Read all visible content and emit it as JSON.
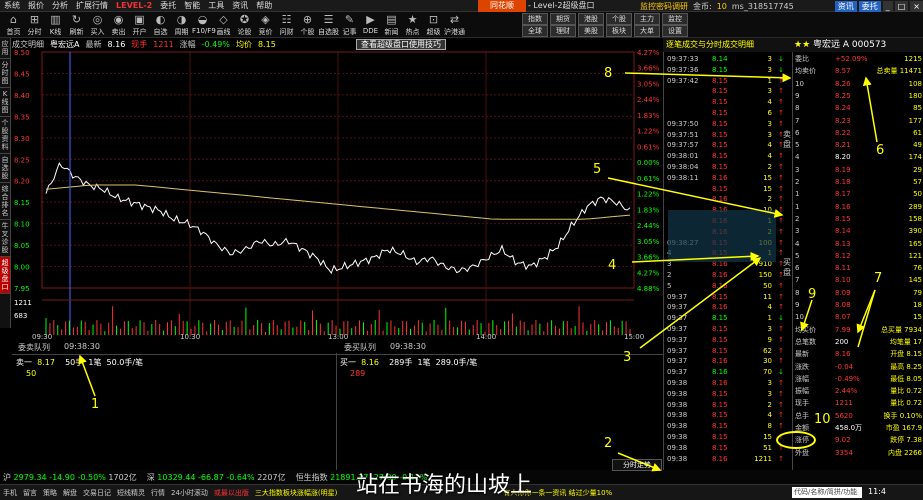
{
  "menubar": {
    "items": [
      "系统",
      "报价",
      "分析",
      "扩展行情",
      "LEVEL-2",
      "委托",
      "智能",
      "工具",
      "资讯",
      "帮助"
    ],
    "logo": "同花顺",
    "center_title": "- Level-2超级盘口",
    "account": "监控密码调研",
    "gold_label": "金币:",
    "gold_value": "10",
    "user": "ms_318517745",
    "btn1": "资讯",
    "btn2": "委托"
  },
  "toolbar": {
    "buttons": [
      {
        "icon": "⌂",
        "label": "首页"
      },
      {
        "icon": "⊞",
        "label": "分时"
      },
      {
        "icon": "▥",
        "label": "K线"
      },
      {
        "icon": "↻",
        "label": "刷新"
      },
      {
        "icon": "◎",
        "label": "买入"
      },
      {
        "icon": "◉",
        "label": "卖出"
      },
      {
        "icon": "▣",
        "label": "开户"
      },
      {
        "icon": "◐",
        "label": "自选"
      },
      {
        "icon": "◑",
        "label": "周期"
      },
      {
        "icon": "◒",
        "label": "F10/F9"
      },
      {
        "icon": "◇",
        "label": "画线"
      },
      {
        "icon": "✪",
        "label": "论股"
      },
      {
        "icon": "◈",
        "label": "竞价"
      },
      {
        "icon": "☷",
        "label": "问财"
      },
      {
        "icon": "⊕",
        "label": "个股"
      },
      {
        "icon": "☰",
        "label": "自选股"
      },
      {
        "icon": "✎",
        "label": "记事"
      },
      {
        "icon": "▶",
        "label": "DDE"
      },
      {
        "icon": "▤",
        "label": "新闻"
      },
      {
        "icon": "★",
        "label": "热点"
      },
      {
        "icon": "⊡",
        "label": "超级"
      },
      {
        "icon": "⇄",
        "label": "沪港通"
      }
    ],
    "right_buttons": [
      "指数",
      "全球",
      "期货",
      "理财",
      "港股",
      "美股",
      "个股",
      "板块",
      "主力",
      "大单",
      "监控",
      "设置"
    ]
  },
  "side_tabs": [
    "应用",
    "分时图",
    "K线图",
    "个股资料",
    "自选股",
    "综合排名",
    "牛叉诊股",
    "超级盘口"
  ],
  "chart_header": {
    "panel": "成交明细",
    "name": "粤宏远A",
    "last_label": "最新",
    "last": "8.16",
    "hand_label": "现手",
    "hand": "1211",
    "change_label": "涨幅",
    "change": "-0.49%",
    "avg_label": "均价",
    "avg": "8.15",
    "super_button": "查看超级盘口使用技巧"
  },
  "chart_data": {
    "type": "line",
    "title": "",
    "series": [
      {
        "name": "价格",
        "color": "#ffffff"
      },
      {
        "name": "均价",
        "color": "#d9c36a"
      }
    ],
    "ylim": [
      7.95,
      8.5
    ],
    "y_ticks_left": [
      "8.50",
      "8.45",
      "8.40",
      "8.35",
      "8.30",
      "8.25",
      "8.20",
      "8.15",
      "8.10",
      "8.05",
      "8.00",
      "7.95"
    ],
    "y_ticks_right": [
      "4.27%",
      "3.66%",
      "3.05%",
      "2.44%",
      "1.83%",
      "1.22%",
      "0.61%",
      "0.00%",
      "0.61%",
      "1.22%",
      "1.83%",
      "2.44%",
      "3.05%",
      "3.66%",
      "4.27%",
      "4.88%"
    ],
    "x_ticks": [
      "09:30",
      "10:30",
      "13:00",
      "14:00",
      "15:00"
    ],
    "volume_tick": "1211",
    "volume_low": "683"
  },
  "queues": {
    "sell_head": "委卖队列",
    "sell_time": "09:38:30",
    "buy_head": "委买队列",
    "buy_time": "09:38:30",
    "sell_row": {
      "label": "卖一",
      "price": "8.17",
      "size": "50手",
      "count": "1笔",
      "avg": "50.0手/笔",
      "value": "50"
    },
    "buy_row": {
      "label": "买一",
      "price": "8.16",
      "size": "289手",
      "count": "1笔",
      "avg": "289.0手/笔",
      "value": "289"
    }
  },
  "ticks_panel": {
    "title": "逐笔成交与分时成交明细",
    "rows": [
      {
        "t": "09:37:33",
        "p": "8.14",
        "v": "3",
        "a": "5",
        "g": true
      },
      {
        "t": "09:37:36",
        "p": "8.15",
        "v": "3",
        "a": "4",
        "g": true
      },
      {
        "t": "09:37:42",
        "p": "8.15",
        "v": "1",
        "a": "2",
        "g": false
      },
      {
        "t": "",
        "p": "8.15",
        "v": "3",
        "a": "1",
        "g": false
      },
      {
        "t": "",
        "p": "8.15",
        "v": "4",
        "a": "2",
        "g": false
      },
      {
        "t": "",
        "p": "8.15",
        "v": "6",
        "a": "1",
        "g": false
      },
      {
        "t": "09:37:50",
        "p": "8.15",
        "v": "3",
        "a": "3",
        "g": false
      },
      {
        "t": "09:37:51",
        "p": "8.15",
        "v": "3",
        "a": "1",
        "g": false
      },
      {
        "t": "09:37:57",
        "p": "8.15",
        "v": "4",
        "a": "2",
        "g": false
      },
      {
        "t": "09:38:01",
        "p": "8.15",
        "v": "4",
        "a": "2",
        "g": false
      },
      {
        "t": "09:38:04",
        "p": "8.15",
        "v": "2",
        "a": "1",
        "g": false
      },
      {
        "t": "09:38:11",
        "p": "8.16",
        "v": "15",
        "a": "1",
        "g": false
      },
      {
        "t": "",
        "p": "8.15",
        "v": "15",
        "a": "1",
        "g": false
      },
      {
        "t": "",
        "p": "8.16",
        "v": "2",
        "a": "1",
        "g": false
      },
      {
        "t": "",
        "p": "8.16",
        "v": "10",
        "a": "1",
        "g": false
      },
      {
        "t": "",
        "p": "8.16",
        "v": "1",
        "a": "1",
        "g": false
      },
      {
        "t": "",
        "p": "8.16",
        "v": "2",
        "a": "1",
        "g": false
      },
      {
        "t": "09:38:27",
        "p": "8.15",
        "v": "100",
        "a": "",
        "g": false
      },
      {
        "t": "4",
        "p": "8.15",
        "v": "1",
        "a": "",
        "g": false
      },
      {
        "t": "3",
        "p": "8.16",
        "v": "910",
        "a": "",
        "g": false
      },
      {
        "t": "2",
        "p": "8.16",
        "v": "150",
        "a": "",
        "g": false
      },
      {
        "t": "5",
        "p": "8.16",
        "v": "50",
        "a": "",
        "g": false
      },
      {
        "t": "09:37",
        "p": "8.15",
        "v": "11",
        "a": "3",
        "g": false
      },
      {
        "t": "09:37",
        "p": "8.16",
        "v": "4",
        "a": "2",
        "g": false
      },
      {
        "t": "09:37",
        "p": "8.15",
        "v": "1",
        "a": "1",
        "g": true
      },
      {
        "t": "09:37",
        "p": "8.15",
        "v": "3",
        "a": "1",
        "g": false
      },
      {
        "t": "09:37",
        "p": "8.15",
        "v": "9",
        "a": "2",
        "g": false
      },
      {
        "t": "09:37",
        "p": "8.15",
        "v": "62",
        "a": "5",
        "g": false
      },
      {
        "t": "09:37",
        "p": "8.16",
        "v": "30",
        "a": "3",
        "g": false
      },
      {
        "t": "09:37",
        "p": "8.16",
        "v": "70",
        "a": "4",
        "g": true
      },
      {
        "t": "09:38",
        "p": "8.16",
        "v": "3",
        "a": "1",
        "g": false
      },
      {
        "t": "09:38",
        "p": "8.15",
        "v": "3",
        "a": "1",
        "g": false
      },
      {
        "t": "09:38",
        "p": "8.15",
        "v": "2",
        "a": "1",
        "g": false
      },
      {
        "t": "09:38",
        "p": "8.15",
        "v": "4",
        "a": "3",
        "g": false
      },
      {
        "t": "09:38",
        "p": "8.15",
        "v": "8",
        "a": "5",
        "g": false
      },
      {
        "t": "09:38",
        "p": "8.15",
        "v": "15",
        "a": "1",
        "g": false
      },
      {
        "t": "09:38",
        "p": "8.15",
        "v": "51",
        "a": "3",
        "g": false
      },
      {
        "t": "09:38",
        "p": "8.16",
        "v": "1211",
        "a": "5",
        "g": false
      }
    ],
    "side_sell": "卖盘",
    "side_buy": "买盘"
  },
  "quote_panel": {
    "name": "粤宏远 A",
    "code": "000573",
    "rows": [
      {
        "a": "委比",
        "b": "+52.09%",
        "c": "1215",
        "bw": false
      },
      {
        "a": "均卖价",
        "b": "8.57",
        "c": "总卖量 11471",
        "bw": false
      },
      {
        "a": "10",
        "b": "8.26",
        "c": "108",
        "bw": false
      },
      {
        "a": "9",
        "b": "8.25",
        "c": "180",
        "bw": false
      },
      {
        "a": "8",
        "b": "8.24",
        "c": "85",
        "bw": false
      },
      {
        "a": "7",
        "b": "8.23",
        "c": "177",
        "bw": false
      },
      {
        "a": "6",
        "b": "8.22",
        "c": "61",
        "bw": false
      },
      {
        "a": "5",
        "b": "8.21",
        "c": "49",
        "bw": false
      },
      {
        "a": "4",
        "b": "8.20",
        "c": "174",
        "bw": true
      },
      {
        "a": "3",
        "b": "8.19",
        "c": "29",
        "bw": false
      },
      {
        "a": "2",
        "b": "8.18",
        "c": "57",
        "bw": false
      },
      {
        "a": "1",
        "b": "8.17",
        "c": "50",
        "bw": false
      },
      {
        "a": "1",
        "b": "8.16",
        "c": "289",
        "bw": false
      },
      {
        "a": "2",
        "b": "8.15",
        "c": "158",
        "bw": false
      },
      {
        "a": "3",
        "b": "8.14",
        "c": "390",
        "bw": false
      },
      {
        "a": "4",
        "b": "8.13",
        "c": "165",
        "bw": false
      },
      {
        "a": "5",
        "b": "8.12",
        "c": "121",
        "bw": false
      },
      {
        "a": "6",
        "b": "8.11",
        "c": "76",
        "bw": false
      },
      {
        "a": "7",
        "b": "8.10",
        "c": "145",
        "bw": false
      },
      {
        "a": "8",
        "b": "8.09",
        "c": "79",
        "bw": false
      },
      {
        "a": "9",
        "b": "8.08",
        "c": "18",
        "bw": false
      },
      {
        "a": "10",
        "b": "8.07",
        "c": "15",
        "bw": false
      },
      {
        "a": "均买价",
        "b": "7.99",
        "c": "总买量 7934",
        "bw": false
      },
      {
        "a": "总笔数",
        "b": "200",
        "c": "均笔量 17",
        "bw": true
      },
      {
        "a": "最新",
        "b": "8.16",
        "c": "开盘 8.15",
        "bw": false
      },
      {
        "a": "涨跌",
        "b": "-0.04",
        "c": "最高 8.25",
        "bw": false
      },
      {
        "a": "涨幅",
        "b": "-0.49%",
        "c": "最低 8.05",
        "bw": false
      },
      {
        "a": "振幅",
        "b": "2.44%",
        "c": "量比 0.72",
        "bw": false
      },
      {
        "a": "现手",
        "b": "1211",
        "c": "量比 0.72",
        "bw": false
      },
      {
        "a": "总手",
        "b": "5620",
        "c": "换手 0.10%",
        "bw": false
      },
      {
        "a": "金额",
        "b": "458.0万",
        "c": "市盈 167.9",
        "bw": true
      },
      {
        "a": "涨停",
        "b": "9.02",
        "c": "跌停 7.38",
        "bw": false
      },
      {
        "a": "外盘",
        "b": "3354",
        "c": "内盘 2266",
        "bw": false
      }
    ]
  },
  "bottom_index": {
    "items": [
      {
        "label": "沪",
        "value": "2979.34",
        "chg": "-14.90",
        "pct": "-0.50%",
        "amt": "1702亿"
      },
      {
        "label": "深",
        "value": "10329.44",
        "chg": "-66.87",
        "pct": "-0.64%",
        "amt": "2207亿"
      },
      {
        "label": "恒生指数",
        "value": "21891.37",
        "chg": "-27.00",
        "pct": "-0.12%"
      }
    ],
    "fenshi_tab": "分时走势"
  },
  "status_bar": {
    "items": [
      "手机",
      "留言",
      "策略",
      "解盘",
      "交易日记",
      "短线精灵",
      "行情",
      "24小时滚动"
    ],
    "ticker1": "或最以出版",
    "ticker2": "三大指数板块涨幅涨(明星)",
    "ticker3": "有人你你一条一资讯 结过少量10%",
    "search_placeholder": "代码/名称/简拼/功能",
    "time": "11:4"
  },
  "subtitle": "站在书海的山坡上",
  "annotations": [
    "1",
    "2",
    "3",
    "4",
    "5",
    "6",
    "7",
    "8",
    "9",
    "10"
  ]
}
